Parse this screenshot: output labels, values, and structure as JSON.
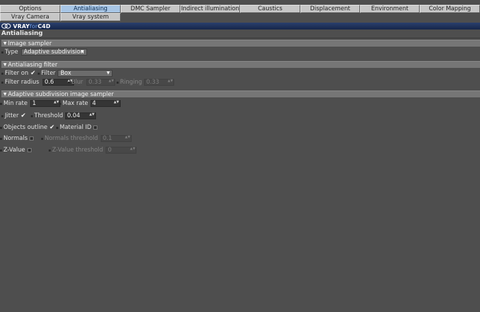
{
  "tabs_row1": [
    "Options",
    "Antialiasing",
    "DMC Sampler",
    "Indirect illumination (GI)",
    "Caustics",
    "Displacement",
    "Environment",
    "Color Mapping"
  ],
  "tabs_row2": [
    "Vray Camera",
    "Vray system"
  ],
  "active_tab": "Antialiasing",
  "logo": {
    "a": "VRAY",
    "b": "for",
    "c": "C4D"
  },
  "page_title": "Antialiasing",
  "image_sampler": {
    "header": "Image sampler",
    "type_label": "Type",
    "type_value": "Adaptive subdivision"
  },
  "aa_filter": {
    "header": "Antialiasing filter",
    "filter_on_label": "Filter on",
    "filter_label": "Filter",
    "filter_value": "Box",
    "radius_label": "Filter radius",
    "radius_value": "0.6",
    "blur_label": "Blur",
    "blur_value": "0.33",
    "ringing_label": "Ringing",
    "ringing_value": "0.33"
  },
  "adaptive": {
    "header": "Adaptive subdivision image sampler",
    "min_rate_label": "Min rate",
    "min_rate_value": "1",
    "max_rate_label": "Max rate",
    "max_rate_value": "4",
    "jitter_label": "Jitter",
    "threshold_label": "Threshold",
    "threshold_value": "0.04",
    "objects_outline_label": "Objects outline",
    "material_id_label": "Material ID",
    "normals_label": "Normals",
    "normals_threshold_label": "Normals threshold",
    "normals_threshold_value": "0.1",
    "zvalue_label": "Z-Value",
    "zvalue_threshold_label": "Z-Value threshold",
    "zvalue_threshold_value": "0"
  },
  "glyphs": {
    "check": "✔",
    "tri_down": "▼",
    "spin": "▲▼"
  }
}
